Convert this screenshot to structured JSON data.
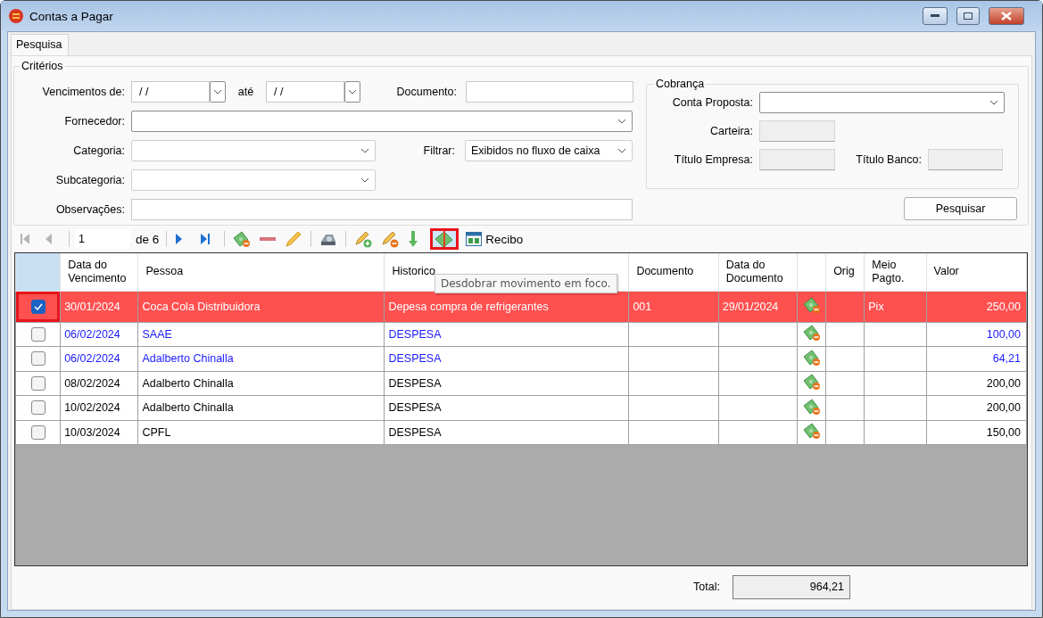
{
  "window": {
    "title": "Contas a Pagar"
  },
  "tabs": [
    {
      "label": "Pesquisa",
      "selected": true
    }
  ],
  "criteria": {
    "title": "Critérios",
    "due_from": {
      "label": "Vencimentos de:",
      "value": "/ /"
    },
    "due_to": {
      "label": "até",
      "value": "/ /"
    },
    "document": {
      "label": "Documento:"
    },
    "supplier": {
      "label": "Fornecedor:"
    },
    "category": {
      "label": "Categoria:"
    },
    "filter": {
      "label": "Filtrar:",
      "value": "Exibidos no fluxo de caixa"
    },
    "subcategory": {
      "label": "Subcategoria:"
    },
    "notes": {
      "label": "Observações:"
    }
  },
  "billing": {
    "title": "Cobrança",
    "account": {
      "label": "Conta Proposta:"
    },
    "wallet": {
      "label": "Carteira:"
    },
    "company_title": {
      "label": "Título Empresa:"
    },
    "bank_title": {
      "label": "Título Banco:"
    }
  },
  "search_button": "Pesquisar",
  "toolbar": {
    "page": "1",
    "page_count": "de 6",
    "nav_back": [
      {
        "kind": "first",
        "disabled": true
      },
      {
        "kind": "prev",
        "disabled": true
      }
    ],
    "nav_forward": [
      {
        "kind": "next",
        "disabled": false
      },
      {
        "kind": "last",
        "disabled": false
      }
    ],
    "actions": [
      {
        "kind": "money",
        "highlighted": false
      },
      {
        "kind": "minus",
        "highlighted": false
      },
      {
        "kind": "pencil",
        "highlighted": false
      },
      {
        "kind": "sep"
      },
      {
        "kind": "scanner",
        "highlighted": false
      },
      {
        "kind": "sep"
      },
      {
        "kind": "pencil_add",
        "highlighted": false
      },
      {
        "kind": "pencil_remove",
        "highlighted": false
      },
      {
        "kind": "down",
        "highlighted": false
      },
      {
        "kind": "split",
        "highlighted": true
      },
      {
        "kind": "receipt",
        "label": "Recibo",
        "highlighted": false
      }
    ],
    "tooltip": "Desdobrar movimento em foco."
  },
  "table": {
    "columns": [
      {
        "kind": "text",
        "label": "Data do Vencimento"
      },
      {
        "kind": "text",
        "label": "Pessoa"
      },
      {
        "kind": "text",
        "label": "Historico"
      },
      {
        "kind": "text",
        "label": "Documento"
      },
      {
        "kind": "text",
        "label": "Data do Documento"
      },
      {
        "kind": "icon"
      },
      {
        "kind": "text",
        "label": "Orig"
      },
      {
        "kind": "text",
        "label": "Meio Pagto."
      },
      {
        "kind": "text",
        "label": "Valor"
      }
    ],
    "rows": [
      {
        "checked": true,
        "selected": true,
        "highlighted": true,
        "due": "30/01/2024",
        "person": "Coca Cola Distribuidora",
        "history": "Depesa compra de refrigerantes",
        "document": "001",
        "doc_date": "29/01/2024",
        "payment": "Pix",
        "value": "250,00"
      },
      {
        "checked": false,
        "selected": false,
        "highlighted": false,
        "color": "#1a1aff",
        "due": "06/02/2024",
        "person": "SAAE",
        "history": "DESPESA",
        "value": "100,00"
      },
      {
        "checked": false,
        "selected": false,
        "highlighted": false,
        "color": "#1a1aff",
        "due": "06/02/2024",
        "person": "Adalberto Chinalla",
        "history": "DESPESA",
        "value": "64,21"
      },
      {
        "checked": false,
        "selected": false,
        "highlighted": false,
        "color": "#000000",
        "due": "08/02/2024",
        "person": "Adalberto Chinalla",
        "history": "DESPESA",
        "value": "200,00"
      },
      {
        "checked": false,
        "selected": false,
        "highlighted": false,
        "color": "#000000",
        "due": "10/02/2024",
        "person": "Adalberto Chinalla",
        "history": "DESPESA",
        "value": "200,00"
      },
      {
        "checked": false,
        "selected": false,
        "highlighted": false,
        "color": "#000000",
        "due": "10/03/2024",
        "person": "CPFL",
        "history": "DESPESA",
        "value": "150,00"
      }
    ]
  },
  "total": {
    "label": "Total:",
    "value": "964,21"
  }
}
